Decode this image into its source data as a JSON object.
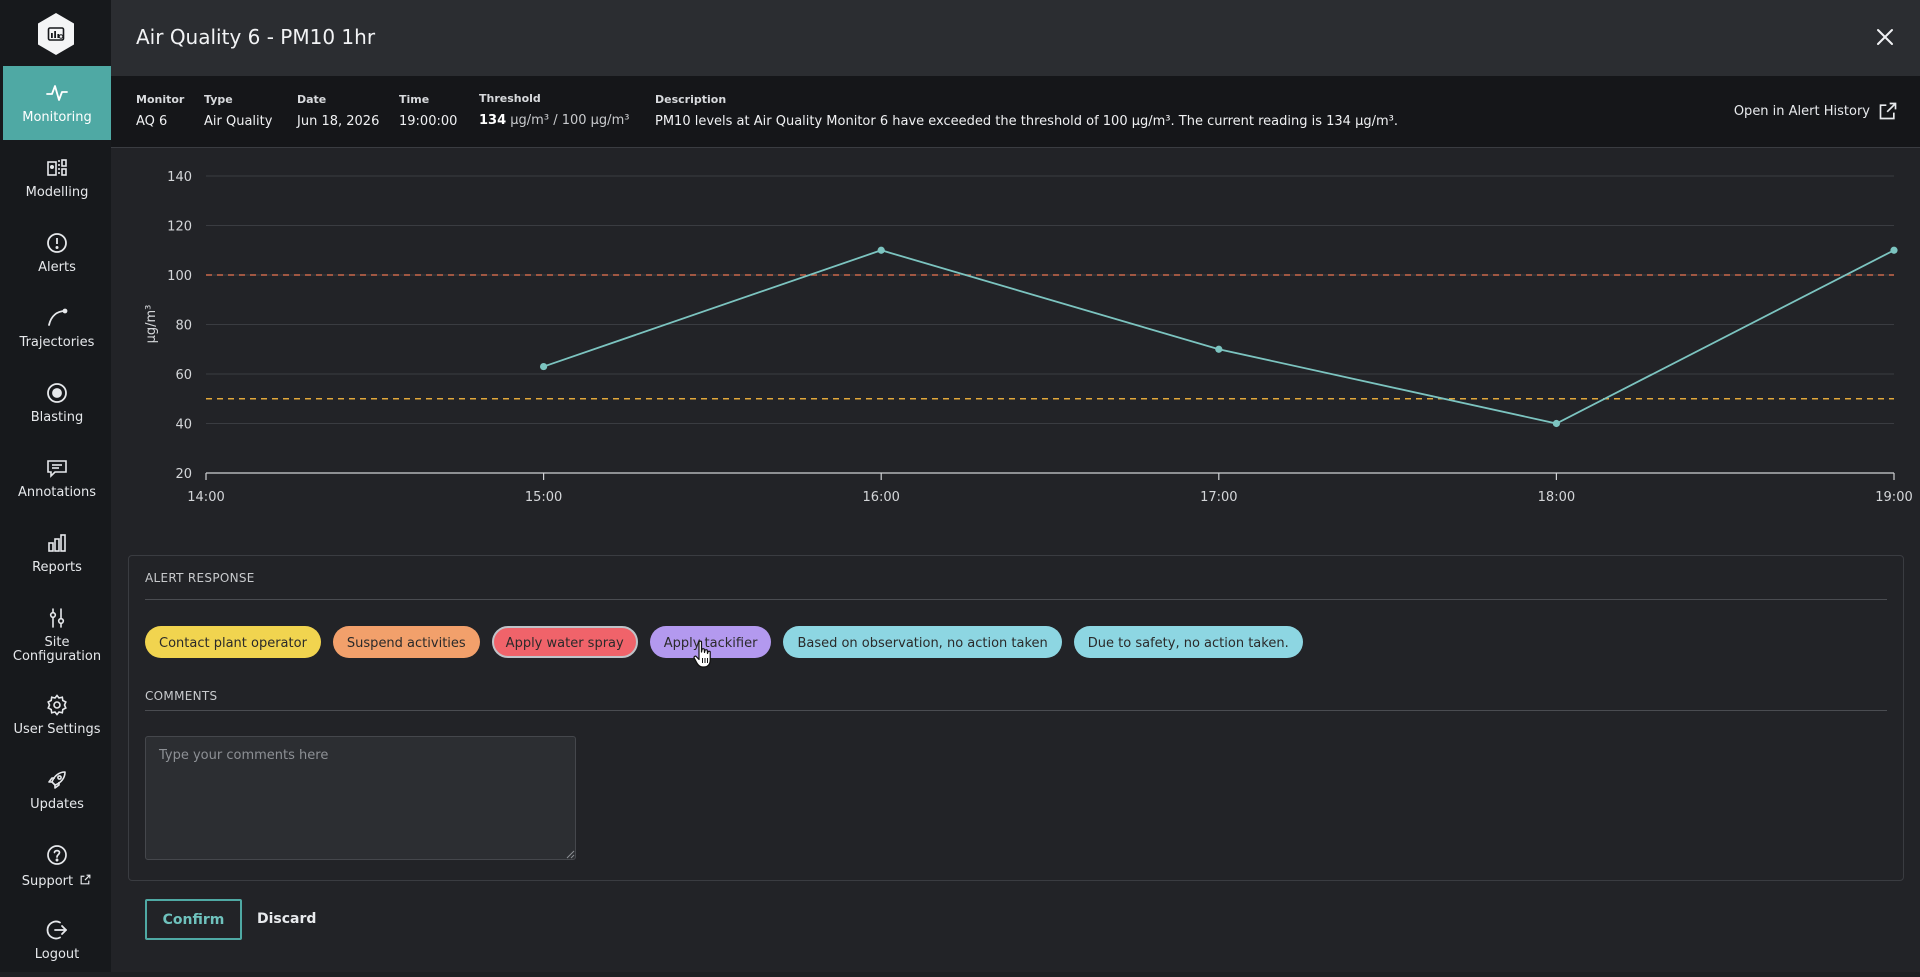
{
  "sidebar": {
    "items": [
      {
        "label": "Monitoring",
        "icon": "pulse-icon",
        "active": true
      },
      {
        "label": "Modelling",
        "icon": "modelling-icon"
      },
      {
        "label": "Alerts",
        "icon": "alert-circle-icon"
      },
      {
        "label": "Trajectories",
        "icon": "trajectory-icon"
      },
      {
        "label": "Blasting",
        "icon": "target-icon"
      },
      {
        "label": "Annotations",
        "icon": "comment-icon"
      },
      {
        "label": "Reports",
        "icon": "bar-chart-icon"
      },
      {
        "label_line1": "Site",
        "label_line2": "Configuration",
        "icon": "sliders-icon"
      },
      {
        "label": "User Settings",
        "icon": "gear-icon"
      },
      {
        "label": "Updates",
        "icon": "rocket-icon"
      },
      {
        "label": "Support",
        "icon": "help-circle-icon"
      },
      {
        "label": "Logout",
        "icon": "logout-icon"
      }
    ]
  },
  "modal": {
    "title": "Air Quality 6 - PM10 1hr",
    "info": {
      "monitor_label": "Monitor",
      "monitor_value": "AQ 6",
      "type_label": "Type",
      "type_value": "Air Quality",
      "date_label": "Date",
      "date_value": "Jun 18, 2026",
      "time_label": "Time",
      "time_value": "19:00:00",
      "threshold_label": "Threshold",
      "threshold_current": "134",
      "threshold_unit_current": "μg/m³",
      "threshold_limit": "/ 100 μg/m³",
      "description_label": "Description",
      "description_value": "PM10 levels at Air Quality Monitor 6 have exceeded the threshold of 100 μg/m³. The current reading is 134 μg/m³."
    },
    "open_alert_history": "Open in Alert History"
  },
  "chart_data": {
    "type": "line",
    "ylabel": "μg/m³",
    "ylim": [
      20,
      140
    ],
    "yticks": [
      20,
      40,
      60,
      80,
      100,
      120,
      140
    ],
    "xticks": [
      "14:00",
      "15:00",
      "16:00",
      "17:00",
      "18:00",
      "19:00"
    ],
    "series": [
      {
        "x": [
          "15:00",
          "16:00",
          "17:00",
          "18:00",
          "19:00"
        ],
        "values": [
          63,
          110,
          70,
          40,
          110
        ],
        "color": "#7cc4c0"
      }
    ],
    "thresholds": [
      {
        "value": 100,
        "color": "#c9694c"
      },
      {
        "value": 50,
        "color": "#e3a83a"
      }
    ],
    "grid": true
  },
  "alert_response": {
    "label": "ALERT RESPONSE",
    "options": [
      {
        "label": "Contact plant operator",
        "color": "#f1d44f"
      },
      {
        "label": "Suspend activities",
        "color": "#f2a06b"
      },
      {
        "label": "Apply water spray",
        "color": "#f0636a",
        "selected": true
      },
      {
        "label": "Apply tackifier",
        "color": "#b399ef"
      },
      {
        "label": "Based on observation, no action taken",
        "color": "#8dd6e2"
      },
      {
        "label": "Due to safety, no action taken.",
        "color": "#8dd6e2"
      }
    ]
  },
  "comments": {
    "label": "COMMENTS",
    "placeholder": "Type your comments here",
    "value": ""
  },
  "actions": {
    "confirm_label": "Confirm",
    "discard_label": "Discard"
  },
  "colors": {
    "accent": "#4fa9a4",
    "sidebar_bg": "#17191c",
    "panel_bg": "#222327"
  }
}
